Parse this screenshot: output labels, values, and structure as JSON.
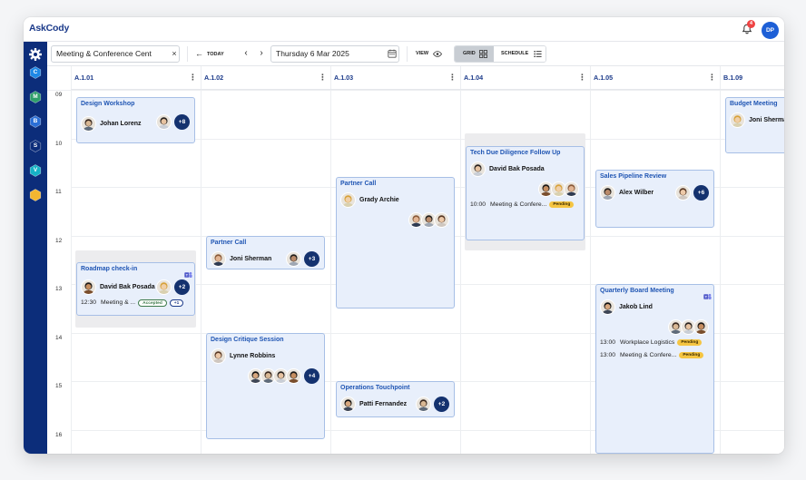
{
  "app": {
    "logo": "AskCody"
  },
  "header": {
    "notification_count": "4",
    "user_initials": "DP"
  },
  "sidebar": {
    "apps": [
      {
        "letter": "C",
        "color": "#1e88e5"
      },
      {
        "letter": "M",
        "color": "#2e9e6a"
      },
      {
        "letter": "B",
        "color": "#2b6fd6"
      },
      {
        "letter": "S",
        "color": "#0c2d7a"
      },
      {
        "letter": "V",
        "color": "#16b3c6"
      },
      {
        "letter": "",
        "color": "#f2b631"
      }
    ]
  },
  "toolbar": {
    "location_value": "Meeting & Conference Cent",
    "clear_glyph": "×",
    "today_label": "TODAY",
    "date_value": "Thursday 6 Mar 2025",
    "view_label": "VIEW",
    "grid_label": "GRID",
    "schedule_label": "SCHEDULE"
  },
  "rooms": [
    "A.1.01",
    "A.1.02",
    "A.1.03",
    "A.1.04",
    "A.1.05",
    "B.1.09"
  ],
  "hours": [
    "09",
    "10",
    "11",
    "12",
    "13",
    "14",
    "15",
    "16"
  ],
  "events": [
    {
      "title": "Design Workshop",
      "organizer": "Johan Lorenz",
      "more": "+8"
    },
    {
      "title": "Roadmap check-in",
      "organizer": "David Bak Posada",
      "more": "+2",
      "time": "12:30",
      "room": "Meeting & ...",
      "status": "Accepted",
      "extra": "+1"
    },
    {
      "title": "Partner Call",
      "organizer": "Joni Sherman",
      "more": "+3"
    },
    {
      "title": "Design Critique Session",
      "organizer": "Lynne Robbins",
      "more": "+4"
    },
    {
      "title": "Partner Call",
      "organizer": "Grady Archie"
    },
    {
      "title": "Operations Touchpoint",
      "organizer": "Patti Fernandez",
      "more": "+2"
    },
    {
      "title": "Tech Due Diligence Follow Up",
      "organizer": "David Bak Posada",
      "time": "10:00",
      "room": "Meeting & Confere...",
      "status": "Pending"
    },
    {
      "title": "Sales Pipeline Review",
      "organizer": "Alex Wilber",
      "more": "+6"
    },
    {
      "title": "Quarterly Board Meeting",
      "organizer": "Jakob Lind",
      "rows": [
        {
          "time": "13:00",
          "room": "Workplace Logistics",
          "status": "Pending"
        },
        {
          "time": "13:00",
          "room": "Meeting & Confere...",
          "status": "Pending"
        }
      ]
    },
    {
      "title": "Budget Meeting",
      "organizer": "Joni Sherman"
    }
  ]
}
